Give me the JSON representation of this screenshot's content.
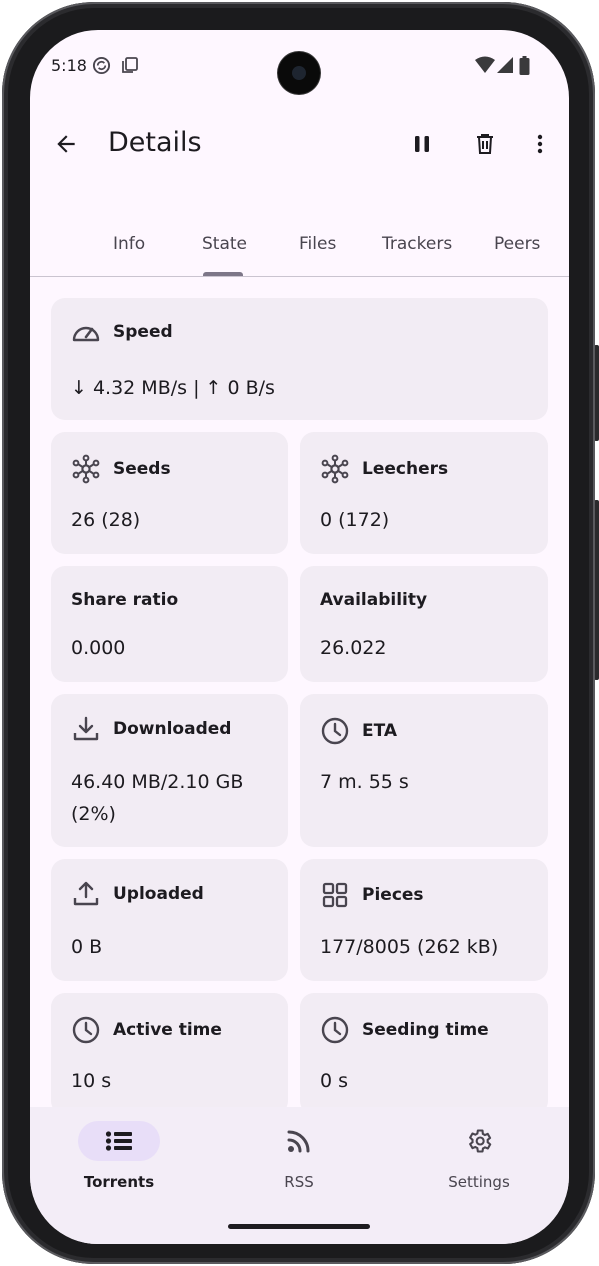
{
  "status": {
    "time": "5:18"
  },
  "topbar": {
    "title": "Details"
  },
  "tabs": [
    {
      "label": "Info"
    },
    {
      "label": "State"
    },
    {
      "label": "Files"
    },
    {
      "label": "Trackers"
    },
    {
      "label": "Peers"
    }
  ],
  "active_tab": "State",
  "cards": {
    "speed": {
      "label": "Speed",
      "value": "↓ 4.32 MB/s | ↑ 0 B/s"
    },
    "seeds": {
      "label": "Seeds",
      "value": "26 (28)"
    },
    "leechers": {
      "label": "Leechers",
      "value": "0 (172)"
    },
    "share_ratio": {
      "label": "Share ratio",
      "value": "0.000"
    },
    "availability": {
      "label": "Availability",
      "value": "26.022"
    },
    "downloaded": {
      "label": "Downloaded",
      "value_line1": "46.40 MB/2.10 GB",
      "value_line2": "(2%)"
    },
    "eta": {
      "label": "ETA",
      "value": "7 m. 55 s"
    },
    "uploaded": {
      "label": "Uploaded",
      "value": "0 B"
    },
    "pieces": {
      "label": "Pieces",
      "value": "177/8005 (262 kB)"
    },
    "active_time": {
      "label": "Active time",
      "value": "10 s"
    },
    "seeding_time": {
      "label": "Seeding time",
      "value": "0 s"
    }
  },
  "nav": [
    {
      "label": "Torrents",
      "icon": "list-icon",
      "active": true
    },
    {
      "label": "RSS",
      "icon": "rss-icon",
      "active": false
    },
    {
      "label": "Settings",
      "icon": "gear-icon",
      "active": false
    }
  ],
  "colors": {
    "background": "#fef7ff",
    "card": "#f2ecf4",
    "nav_background": "#f3edf7",
    "nav_active_pill": "#e8def8",
    "text_primary": "#1d1b20",
    "text_secondary": "#49454f"
  }
}
